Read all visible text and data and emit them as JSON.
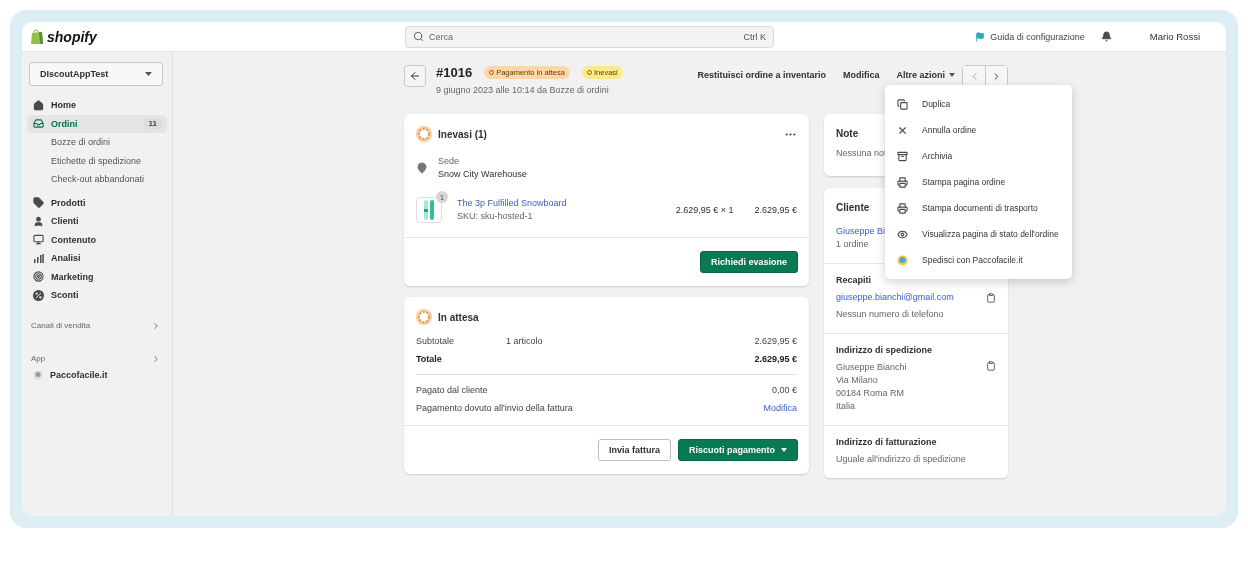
{
  "topbar": {
    "logo": "shopify",
    "search": {
      "placeholder": "Cerca",
      "shortcut": "Ctrl K"
    },
    "setup_guide": "Guida di configurazione",
    "user": "Mario Rossi"
  },
  "sidebar": {
    "store": "DIscoutAppTest",
    "items": [
      {
        "label": "Home",
        "kind": "home",
        "selected": false
      },
      {
        "label": "Ordini",
        "kind": "orders",
        "selected": true,
        "badge": "11",
        "children": [
          {
            "label": "Bozze di ordini",
            "selected": false
          },
          {
            "label": "Etichette di spedizione",
            "selected": false
          },
          {
            "label": "Check-out abbandonati",
            "selected": false
          }
        ]
      },
      {
        "label": "Prodotti",
        "kind": "products",
        "selected": false
      },
      {
        "label": "Clienti",
        "kind": "customers",
        "selected": false
      },
      {
        "label": "Contenuto",
        "kind": "content",
        "selected": false
      },
      {
        "label": "Analisi",
        "kind": "analytics",
        "selected": false
      },
      {
        "label": "Marketing",
        "kind": "marketing",
        "selected": false
      },
      {
        "label": "Sconti",
        "kind": "discounts",
        "selected": false
      }
    ],
    "sales_channels": "Canali di vendita",
    "apps_heading": "App",
    "apps": [
      {
        "label": "Paccofacile.it",
        "selected": false
      }
    ]
  },
  "order": {
    "number": "#1016",
    "badges": [
      {
        "label": "Pagamento in attesa",
        "color": "#ffd6a4"
      },
      {
        "label": "Inevasi",
        "color": "#ffea8a"
      }
    ],
    "subtitle": "9 giugno 2023 alle 10:14 da Bozze di ordini",
    "actions": [
      {
        "label": "Restituisci ordine a inventario",
        "kind": "plain"
      },
      {
        "label": "Modifica",
        "kind": "plain"
      },
      {
        "label": "Altre azioni",
        "kind": "menu"
      }
    ]
  },
  "menu": [
    {
      "label": "Duplica",
      "kind": "duplicate"
    },
    {
      "label": "Annulla ordine",
      "kind": "cancel"
    },
    {
      "label": "Archivia",
      "kind": "archive"
    },
    {
      "label": "Stampa pagina ordine",
      "kind": "print"
    },
    {
      "label": "Stampa documenti di trasporto",
      "kind": "print"
    },
    {
      "label": "Visualizza pagina di stato dell'ordine",
      "kind": "view"
    },
    {
      "label": "Spedisci con Paccofacile.it",
      "kind": "app"
    }
  ],
  "fulfillment": {
    "title": "Inevasi (1)",
    "location_label": "Sede",
    "location": "Snow City Warehouse",
    "item": {
      "quantity": "1",
      "name": "The 3p Fulfilled Snowboard",
      "sku": "SKU: sku-hosted-1",
      "price": "2.629,95 € × 1",
      "total": "2.629,95 €"
    },
    "button": "Richiedi evasione"
  },
  "payment": {
    "title": "In attesa",
    "groups": [
      [
        {
          "label": "Subtotale",
          "detail": "1 articolo",
          "value": "2.629,95 €",
          "kind": "amount"
        },
        {
          "label": "Totale",
          "value": "2.629,95 €",
          "kind": "total"
        }
      ],
      [
        {
          "label": "Pagato dal cliente",
          "value": "0,00 €",
          "kind": "amount"
        },
        {
          "label": "Pagamento dovuto all'invio della fattura",
          "value": "Modifica",
          "kind": "link"
        }
      ]
    ],
    "buttons": [
      {
        "label": "Invia fattura",
        "kind": "secondary"
      },
      {
        "label": "Riscuoti pagamento",
        "kind": "primary"
      }
    ]
  },
  "notes": {
    "title": "Note",
    "text": "Nessuna not"
  },
  "customer": {
    "title": "Cliente",
    "name": "Giuseppe Bi",
    "orders": "1 ordine",
    "contact": {
      "title": "Recapiti",
      "email": "giuseppe.bianchi@gmail.com",
      "phone": "Nessun numero di telefono"
    },
    "shipping": {
      "title": "Indirizzo di spedizione",
      "lines": [
        "Giuseppe Bianchi",
        "Via Milano",
        "00184 Roma RM",
        "Italia"
      ]
    },
    "billing": {
      "title": "Indirizzo di fatturazione",
      "text": "Uguale all'indirizzo di spedizione"
    }
  }
}
